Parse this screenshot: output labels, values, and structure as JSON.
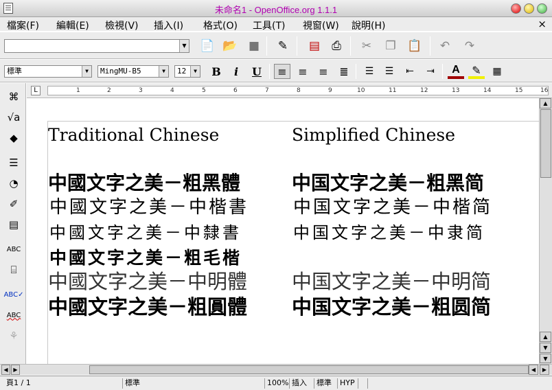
{
  "window": {
    "title": "未命名1 - OpenOffice.org 1.1.1"
  },
  "menu": [
    "檔案(F)",
    "編輯(E)",
    "檢視(V)",
    "插入(I)",
    "格式(O)",
    "工具(T)",
    "視窗(W)",
    "說明(H)"
  ],
  "menu_close": "×",
  "url_field": {
    "value": ""
  },
  "format": {
    "style": "標準",
    "font": "MingMU-B5",
    "size": "12",
    "bold": "B",
    "italic": "i",
    "underline": "U"
  },
  "ruler": {
    "numbers": [
      "1",
      "2",
      "3",
      "4",
      "5",
      "6",
      "7",
      "8",
      "9",
      "10",
      "11",
      "12",
      "13",
      "14",
      "15",
      "16"
    ],
    "tab_selector": "L"
  },
  "document": {
    "headings": {
      "traditional": "Traditional Chinese",
      "simplified": "Simplified Chinese"
    },
    "rows": [
      {
        "traditional": "中國文字之美－粗黑體",
        "simplified": "中国文字之美－粗黑简"
      },
      {
        "traditional": "中國文字之美－中楷書",
        "simplified": "中国文字之美－中楷简"
      },
      {
        "traditional": "中國文字之美－中隸書",
        "simplified": "中国文字之美－中隶简"
      },
      {
        "traditional": "中國文字之美－粗毛楷",
        "simplified": ""
      },
      {
        "traditional": "中國文字之美－中明體",
        "simplified": "中国文字之美－中明简"
      },
      {
        "traditional": "中國文字之美－粗圓體",
        "simplified": "中国文字之美－粗圆简"
      }
    ]
  },
  "status": {
    "page": "頁1 / 1",
    "style": "標準",
    "zoom": "100%",
    "insert": "插入",
    "selection": "標準",
    "hyperlink": "HYP"
  },
  "colors": {
    "title_text": "#b000b0",
    "chrome": "#ececec"
  }
}
